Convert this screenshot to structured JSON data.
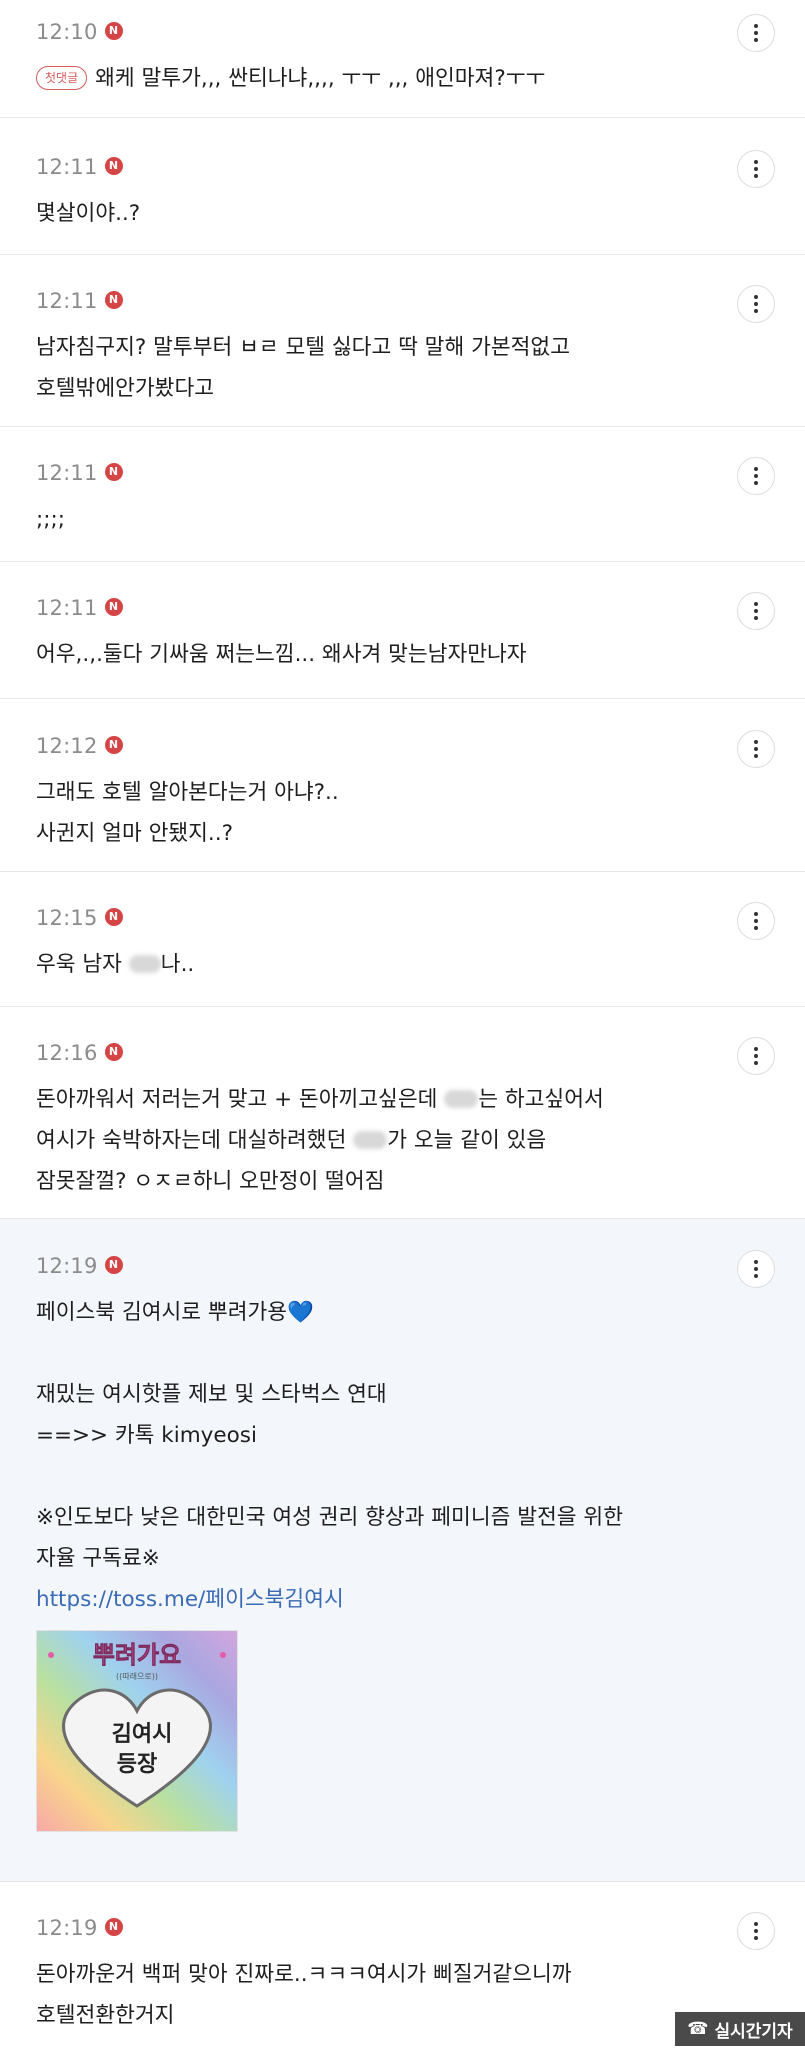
{
  "comments": [
    {
      "time": "12:10",
      "badge": "N",
      "first_tag": "첫댓글",
      "lines": [
        "왜케 말투가,,, 싼티나냐,,,, ㅜㅜ ,,, 애인마져?ㅜㅜ"
      ]
    },
    {
      "time": "12:11",
      "badge": "N",
      "lines": [
        "몇살이야..?"
      ]
    },
    {
      "time": "12:11",
      "badge": "N",
      "lines": [
        "남자침구지? 말투부터 ㅂㄹ 모텔 싫다고 딱 말해 가본적없고",
        "호텔밖에안가봤다고"
      ]
    },
    {
      "time": "12:11",
      "badge": "N",
      "lines": [
        ";;;;"
      ]
    },
    {
      "time": "12:11",
      "badge": "N",
      "lines": [
        "어우,.,.둘다 기싸움 쩌는느낌... 왜사겨 맞는남자만나자"
      ]
    },
    {
      "time": "12:12",
      "badge": "N",
      "lines": [
        "그래도 호텔 알아본다는거 아냐?..",
        "사귄지 얼마 안됐지..?"
      ]
    },
    {
      "time": "12:15",
      "badge": "N",
      "lines": {
        "a": "우욱 남자 ",
        "b": "나.."
      }
    },
    {
      "time": "12:16",
      "badge": "N",
      "lines": {
        "l1a": "돈아까워서 저러는거 맞고 + 돈아끼고싶은데 ",
        "l1b": "는 하고싶어서",
        "l2a": "여시가 숙박하자는데 대실하려했던 ",
        "l2b": "가 오늘 같이 있음",
        "l3": "잠못잘껄? ㅇㅈㄹ하니 오만정이 떨어짐"
      }
    },
    {
      "time": "12:19",
      "badge": "N",
      "l1": "페이스북 김여시로 뿌려가용",
      "heart": "💙",
      "l2": "재밌는 여시핫플 제보 및 스타벅스 연대",
      "l3": "==>> 카톡 kimyeosi",
      "l4": "※인도보다 낮은 대한민국 여성 권리 향상과 페미니즘 발전을 위한",
      "l5": "자율 구독료※",
      "link": "https://toss.me/페이스북김여시",
      "image": {
        "title": "뿌려가요",
        "subtitle": "((따래으로))",
        "line1": "김여시",
        "line2": "등장"
      }
    },
    {
      "time": "12:19",
      "badge": "N",
      "lines": [
        "돈아까운거 백퍼 맞아 진짜로..ㅋㅋㅋ여시가 삐질거같으니까",
        "호텔전환한거지"
      ]
    }
  ],
  "watermark": "실시간기자",
  "colors": {
    "badge": "#d64545",
    "link": "#3a6bb5",
    "highlight_bg": "#f3f6fb"
  }
}
